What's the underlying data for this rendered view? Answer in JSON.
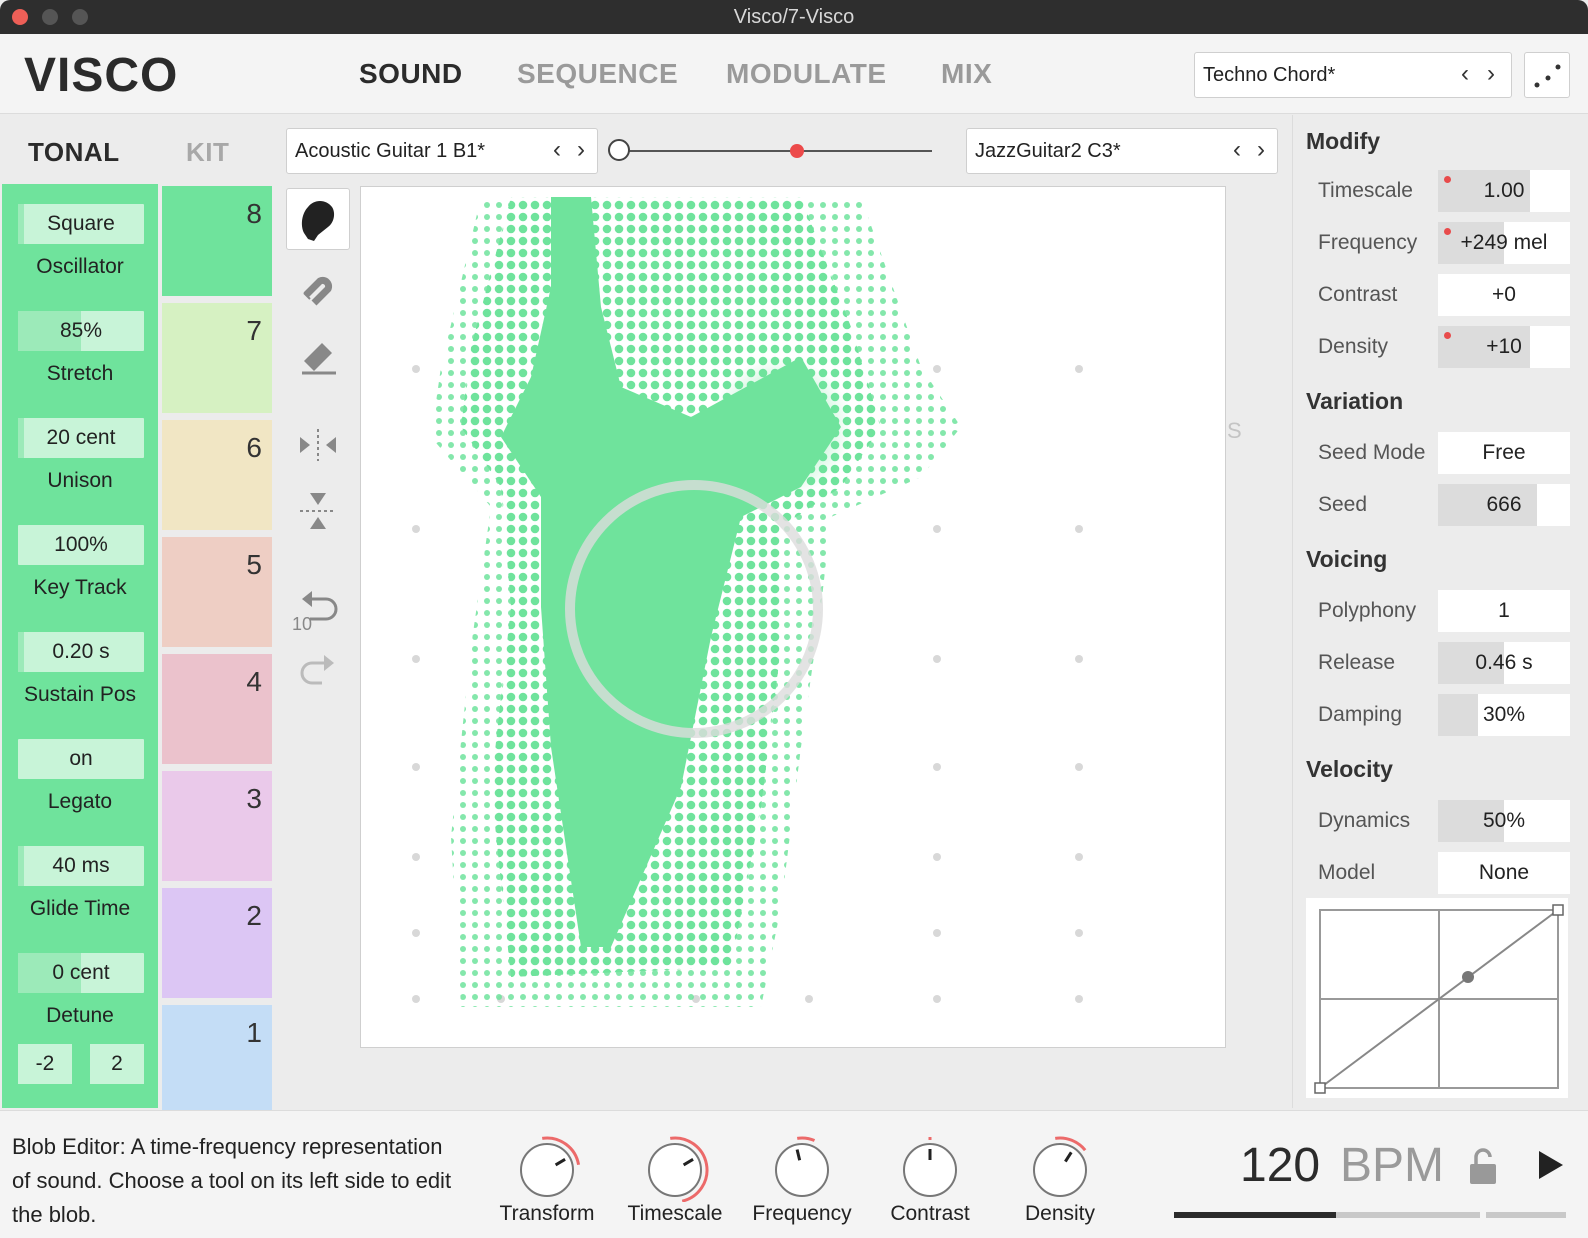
{
  "window": {
    "title": "Visco/7-Visco"
  },
  "header": {
    "logo": "VISCO",
    "tabs": [
      {
        "label": "SOUND",
        "active": true
      },
      {
        "label": "SEQUENCE",
        "active": false
      },
      {
        "label": "MODULATE",
        "active": false
      },
      {
        "label": "MIX",
        "active": false
      }
    ],
    "preset": "Techno Chord*"
  },
  "left": {
    "tab_tonal": "TONAL",
    "tab_kit": "KIT",
    "params": [
      {
        "value": "Square",
        "label": "Oscillator",
        "fill": 0.05
      },
      {
        "value": "85%",
        "label": "Stretch",
        "fill": 0.5
      },
      {
        "value": "20 cent",
        "label": "Unison",
        "fill": 0.05
      },
      {
        "value": "100%",
        "label": "Key Track",
        "fill": 0.0
      },
      {
        "value": "0.20 s",
        "label": "Sustain Pos",
        "fill": 0.05
      },
      {
        "value": "on",
        "label": "Legato",
        "fill": 0.0
      },
      {
        "value": "40 ms",
        "label": "Glide Time",
        "fill": 0.05
      },
      {
        "value": "0 cent",
        "label": "Detune",
        "fill": 0.5
      }
    ],
    "range_min": "-2",
    "range_max": "2"
  },
  "kit_slots": [
    {
      "num": "8",
      "color": "#6fe39c"
    },
    {
      "num": "7",
      "color": "#d6f1c2"
    },
    {
      "num": "6",
      "color": "#f1e6c4"
    },
    {
      "num": "5",
      "color": "#eecec4"
    },
    {
      "num": "4",
      "color": "#ebc2cc"
    },
    {
      "num": "3",
      "color": "#eac9ea"
    },
    {
      "num": "2",
      "color": "#dcc6f4"
    },
    {
      "num": "1",
      "color": "#c4ddf6"
    }
  ],
  "sound_a": "Acoustic Guitar 1 B1*",
  "sound_b": "JazzGuitar2 C3*",
  "blend": 0.57,
  "undo_count": "10",
  "canvas_marker": "S",
  "right": {
    "modify": {
      "title": "Modify",
      "rows": [
        {
          "label": "Timescale",
          "value": "1.00",
          "fill": 0.7,
          "mod": true
        },
        {
          "label": "Frequency",
          "value": "+249 mel",
          "fill": 0.5,
          "mod": true
        },
        {
          "label": "Contrast",
          "value": "+0",
          "fill": 0.0,
          "mod": false
        },
        {
          "label": "Density",
          "value": "+10",
          "fill": 0.7,
          "mod": true
        }
      ]
    },
    "variation": {
      "title": "Variation",
      "rows": [
        {
          "label": "Seed Mode",
          "value": "Free",
          "fill": 0.0,
          "mod": false
        },
        {
          "label": "Seed",
          "value": "666",
          "fill": 0.75,
          "mod": false
        }
      ]
    },
    "voicing": {
      "title": "Voicing",
      "rows": [
        {
          "label": "Polyphony",
          "value": "1",
          "fill": 0.0,
          "mod": false
        },
        {
          "label": "Release",
          "value": "0.46 s",
          "fill": 0.5,
          "mod": false
        },
        {
          "label": "Damping",
          "value": "30%",
          "fill": 0.3,
          "mod": false
        }
      ]
    },
    "velocity": {
      "title": "Velocity",
      "rows": [
        {
          "label": "Dynamics",
          "value": "50%",
          "fill": 0.5,
          "mod": false
        },
        {
          "label": "Model",
          "value": "None",
          "fill": 0.0,
          "mod": false
        }
      ]
    }
  },
  "footer": {
    "help": "Blob Editor: A time-frequency representation of sound. Choose a tool on its left side to edit the blob.",
    "knobs": [
      {
        "label": "Transform",
        "value": 0.72,
        "arc": 0.25
      },
      {
        "label": "Timescale",
        "value": 0.72,
        "arc": 0.55
      },
      {
        "label": "Frequency",
        "value": 0.45,
        "arc": 0.05
      },
      {
        "label": "Contrast",
        "value": 0.5,
        "arc": 0.0
      },
      {
        "label": "Density",
        "value": 0.62,
        "arc": 0.15
      }
    ],
    "bpm": "120",
    "bpm_unit": "BPM",
    "progress": 0.53
  }
}
